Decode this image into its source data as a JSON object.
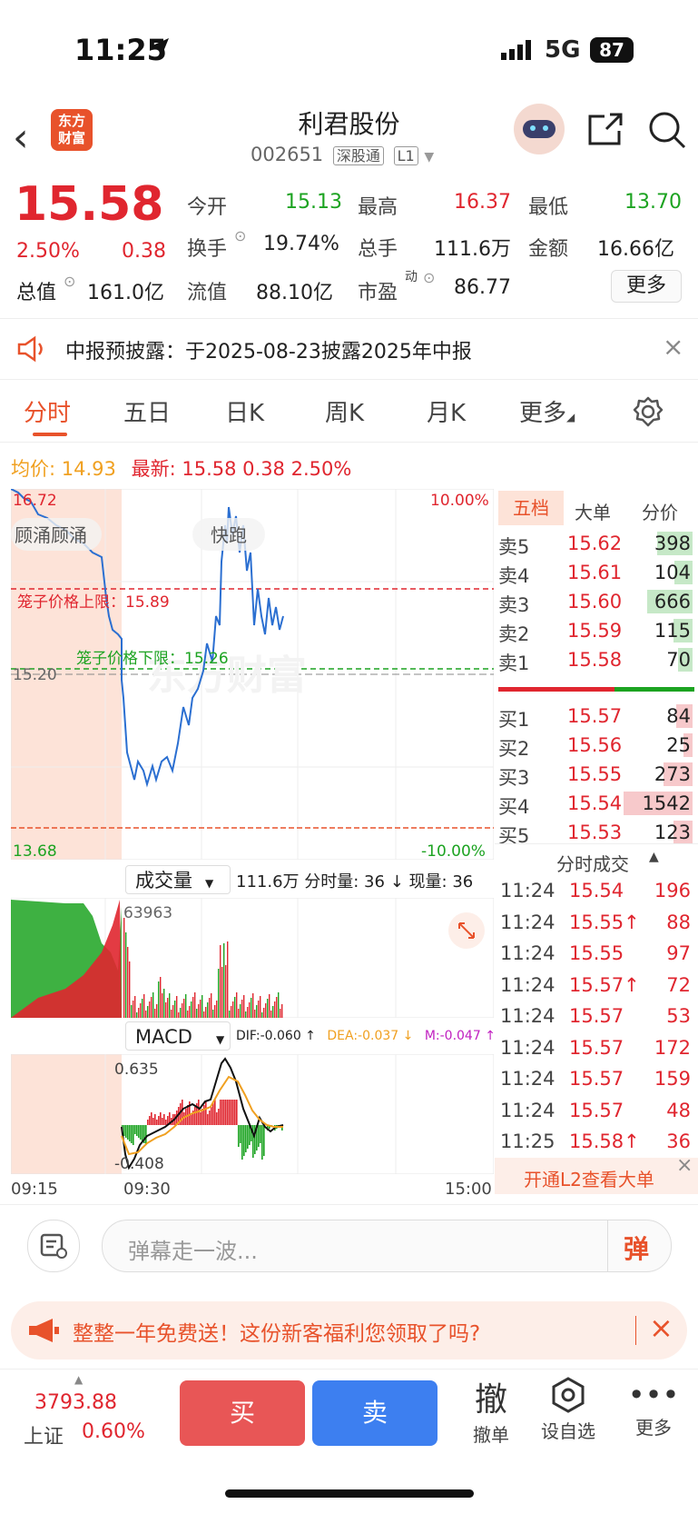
{
  "status_bar": {
    "time": "11:25",
    "network": "5G",
    "battery": "87"
  },
  "header": {
    "title": "利君股份",
    "code": "002651",
    "tag1": "深股通",
    "tag2": "L1",
    "logo_line1": "东方",
    "logo_line2": "财富"
  },
  "quote": {
    "price": "15.58",
    "change_pct": "2.50%",
    "change": "0.38",
    "open_label": "今开",
    "open": "15.13",
    "high_label": "最高",
    "high": "16.37",
    "low_label": "最低",
    "low": "13.70",
    "turnover_label": "换手",
    "turnover": "19.74%",
    "volume_label": "总手",
    "volume": "111.6万",
    "amount_label": "金额",
    "amount": "16.66亿",
    "mktcap_label": "总值",
    "mktcap": "161.0亿",
    "float_label": "流值",
    "float": "88.10亿",
    "pe_label": "市盈",
    "pe_sup": "动",
    "pe": "86.77",
    "more_label": "更多"
  },
  "notice": {
    "text": "中报预披露：于2025-08-23披露2025年中报"
  },
  "tabs": [
    "分时",
    "五日",
    "日K",
    "周K",
    "月K",
    "更多"
  ],
  "intraday": {
    "avg_label": "均价:",
    "avg": "14.93",
    "latest_label": "最新:",
    "latest": "15.58",
    "latest_chg": "0.38",
    "latest_pct": "2.50%",
    "y_top": "16.72",
    "y_mid": "15.20",
    "y_bottom": "13.68",
    "pct_top": "10.00%",
    "pct_bottom": "-10.00%",
    "upper_limit_label": "笼子价格上限：15.89",
    "lower_limit_label": "笼子价格下限：15.26",
    "tag_auction": "顾涌顾涌",
    "tag_run": "快跑",
    "watermark": "东方财富"
  },
  "volume_panel": {
    "selector": "成交量",
    "total": "111.6万",
    "period_label": "分时量: 36",
    "current_label": "现量: 36",
    "max": "63963"
  },
  "macd_panel": {
    "selector": "MACD",
    "dif": "DIF:-0.060 ↑",
    "dea": "DEA:-0.037 ↓",
    "m": "M:-0.047 ↑",
    "top": "0.635",
    "bottom": "-0.408"
  },
  "time_axis": [
    "09:15",
    "09:30",
    "15:00"
  ],
  "orderbook": {
    "tabs": [
      "五档",
      "大单",
      "分价"
    ],
    "asks": [
      {
        "label": "卖5",
        "price": "15.62",
        "vol": "398"
      },
      {
        "label": "卖4",
        "price": "15.61",
        "vol": "104"
      },
      {
        "label": "卖3",
        "price": "15.60",
        "vol": "666"
      },
      {
        "label": "卖2",
        "price": "15.59",
        "vol": "115"
      },
      {
        "label": "卖1",
        "price": "15.58",
        "vol": "70"
      }
    ],
    "bids": [
      {
        "label": "买1",
        "price": "15.57",
        "vol": "84"
      },
      {
        "label": "买2",
        "price": "15.56",
        "vol": "25"
      },
      {
        "label": "买3",
        "price": "15.55",
        "vol": "273"
      },
      {
        "label": "买4",
        "price": "15.54",
        "vol": "1542"
      },
      {
        "label": "买5",
        "price": "15.53",
        "vol": "123"
      }
    ],
    "trades_title": "分时成交",
    "trades": [
      {
        "time": "11:24",
        "price": "15.54",
        "vol": "196"
      },
      {
        "time": "11:24",
        "price": "15.55↑",
        "vol": "88"
      },
      {
        "time": "11:24",
        "price": "15.55",
        "vol": "97"
      },
      {
        "time": "11:24",
        "price": "15.57↑",
        "vol": "72"
      },
      {
        "time": "11:24",
        "price": "15.57",
        "vol": "53"
      },
      {
        "time": "11:24",
        "price": "15.57",
        "vol": "172"
      },
      {
        "time": "11:24",
        "price": "15.57",
        "vol": "159"
      },
      {
        "time": "11:24",
        "price": "15.57",
        "vol": "48"
      },
      {
        "time": "11:25",
        "price": "15.58↑",
        "vol": "36"
      }
    ],
    "l2_label": "开通L2查看大单"
  },
  "comment": {
    "placeholder": "弹幕走一波...",
    "send_label": "弹"
  },
  "promo": {
    "text": "整整一年免费送！这份新客福利您领取了吗?"
  },
  "bottom_bar": {
    "index_value": "3793.88",
    "index_name": "上证",
    "index_pct": "0.60%",
    "buy": "买",
    "sell": "卖",
    "cancel_glyph": "撤",
    "cancel_label": "撤单",
    "watch_label": "设自选",
    "more_label": "更多"
  }
}
